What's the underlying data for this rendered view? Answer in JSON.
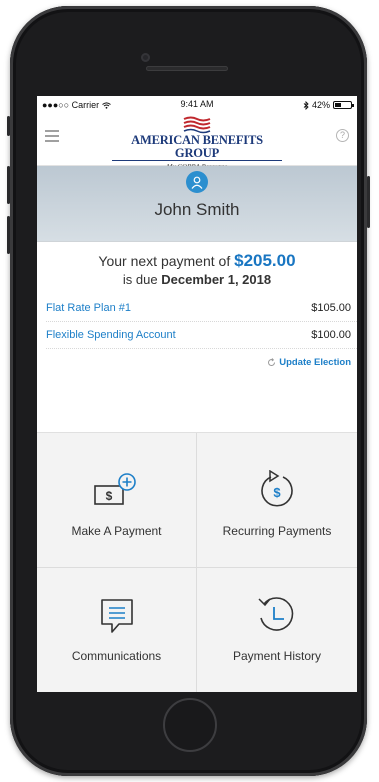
{
  "status_bar": {
    "carrier": "●●●○○ Carrier",
    "time": "9:41 AM",
    "battery_text": "42%",
    "battery_level": 0.42
  },
  "header": {
    "logo_text": "AMERICAN BENEFITS GROUP",
    "logo_subtitle": "My COBRA Resource",
    "help_symbol": "?"
  },
  "profile": {
    "name": "John Smith"
  },
  "payment": {
    "prefix": "Your next payment of",
    "amount": "$205.00",
    "due_prefix": "is due",
    "due_date": "December 1, 2018"
  },
  "plans": [
    {
      "name": "Flat Rate Plan #1",
      "amount": "$105.00"
    },
    {
      "name": "Flexible Spending Account",
      "amount": "$100.00"
    }
  ],
  "update_election_label": "Update Election",
  "tiles": [
    {
      "label": "Make A Payment",
      "icon": "make-payment-icon"
    },
    {
      "label": "Recurring Payments",
      "icon": "recurring-payments-icon"
    },
    {
      "label": "Communications",
      "icon": "communications-icon"
    },
    {
      "label": "Payment History",
      "icon": "payment-history-icon"
    }
  ],
  "colors": {
    "accent": "#1d7fc8",
    "avatar": "#2c8fcf",
    "brand_navy": "#1d3a7a",
    "flag_red": "#c0282e"
  }
}
